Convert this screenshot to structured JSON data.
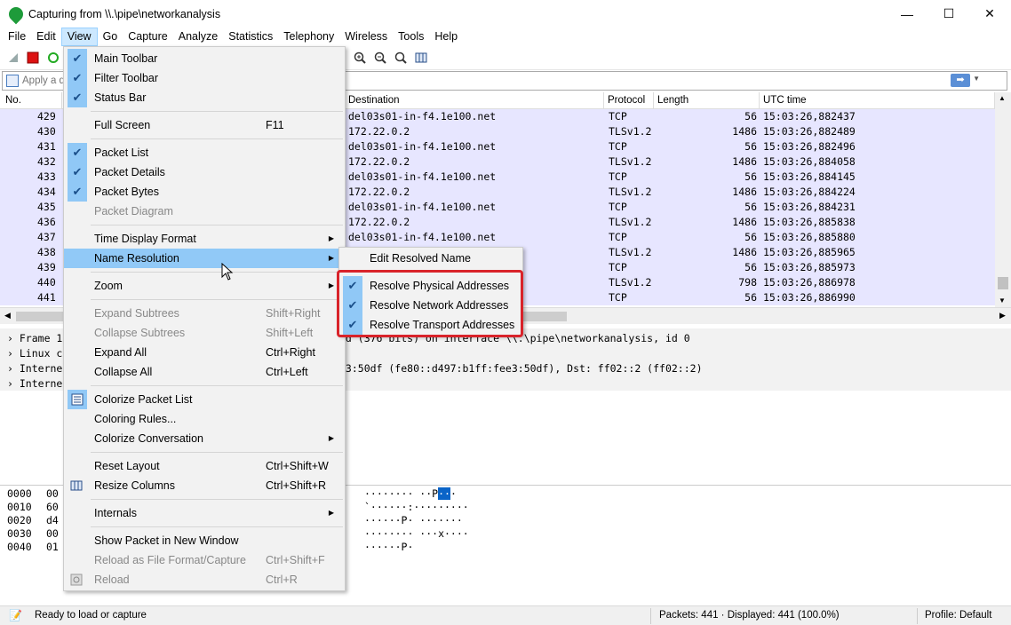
{
  "window": {
    "title": "Capturing from \\\\.\\pipe\\networkanalysis",
    "minimize": "—",
    "maximize": "☐",
    "close": "✕"
  },
  "menubar": [
    "File",
    "Edit",
    "View",
    "Go",
    "Capture",
    "Analyze",
    "Statistics",
    "Telephony",
    "Wireless",
    "Tools",
    "Help"
  ],
  "filter": {
    "placeholder": "Apply a di"
  },
  "packet_list": {
    "headers": {
      "no": "No.",
      "destination": "Destination",
      "protocol": "Protocol",
      "length": "Length",
      "utc": "UTC time"
    },
    "rows": [
      {
        "no": "429",
        "dst": "del03s01-in-f4.1e100.net",
        "proto": "TCP",
        "len": "56",
        "time": "15:03:26,882437"
      },
      {
        "no": "430",
        "dst": "172.22.0.2",
        "proto": "TLSv1.2",
        "len": "1486",
        "time": "15:03:26,882489"
      },
      {
        "no": "431",
        "dst": "del03s01-in-f4.1e100.net",
        "proto": "TCP",
        "len": "56",
        "time": "15:03:26,882496"
      },
      {
        "no": "432",
        "dst": "172.22.0.2",
        "proto": "TLSv1.2",
        "len": "1486",
        "time": "15:03:26,884058"
      },
      {
        "no": "433",
        "dst": "del03s01-in-f4.1e100.net",
        "proto": "TCP",
        "len": "56",
        "time": "15:03:26,884145"
      },
      {
        "no": "434",
        "dst": "172.22.0.2",
        "proto": "TLSv1.2",
        "len": "1486",
        "time": "15:03:26,884224"
      },
      {
        "no": "435",
        "dst": "del03s01-in-f4.1e100.net",
        "proto": "TCP",
        "len": "56",
        "time": "15:03:26,884231"
      },
      {
        "no": "436",
        "dst": "172.22.0.2",
        "proto": "TLSv1.2",
        "len": "1486",
        "time": "15:03:26,885838"
      },
      {
        "no": "437",
        "dst": "del03s01-in-f4.1e100.net",
        "proto": "TCP",
        "len": "56",
        "time": "15:03:26,885880"
      },
      {
        "no": "438",
        "dst": "",
        "proto": "TLSv1.2",
        "len": "1486",
        "time": "15:03:26,885965"
      },
      {
        "no": "439",
        "dst": "",
        "proto": "TCP",
        "len": "56",
        "time": "15:03:26,885973"
      },
      {
        "no": "440",
        "dst": "",
        "proto": "TLSv1.2",
        "len": "798",
        "time": "15:03:26,886978"
      },
      {
        "no": "441",
        "dst": "",
        "proto": "TCP",
        "len": "56",
        "time": "15:03:26,886990"
      }
    ]
  },
  "details": {
    "rows": [
      {
        "left": "Frame 1",
        "right": "ed (376 bits) on interface \\\\.\\pipe\\networkanalysis, id 0"
      },
      {
        "left": "Linux c",
        "right": ""
      },
      {
        "left": "Interne",
        "right": "e3:50df (fe80::d497:b1ff:fee3:50df), Dst: ff02::2 (ff02::2)"
      },
      {
        "left": "Interne",
        "right": ""
      }
    ]
  },
  "bytes": {
    "rows": [
      {
        "offset": "0000",
        "hex": "00",
        "ascii": "········ ··P"
      },
      {
        "offset": "0010",
        "hex": "60",
        "ascii": "`······:·········"
      },
      {
        "offset": "0020",
        "hex": "d4",
        "ascii": "······P· ·······"
      },
      {
        "offset": "0030",
        "hex": "00",
        "ascii": "········ ···x····"
      },
      {
        "offset": "0040",
        "hex": "01",
        "ascii": "······P·"
      }
    ],
    "highlight": "··"
  },
  "view_menu": {
    "items": {
      "main_toolbar": "Main Toolbar",
      "filter_toolbar": "Filter Toolbar",
      "status_bar": "Status Bar",
      "full_screen": "Full Screen",
      "full_screen_sc": "F11",
      "packet_list": "Packet List",
      "packet_details": "Packet Details",
      "packet_bytes": "Packet Bytes",
      "packet_diagram": "Packet Diagram",
      "time_display_format": "Time Display Format",
      "name_resolution": "Name Resolution",
      "zoom": "Zoom",
      "expand_subtrees": "Expand Subtrees",
      "expand_subtrees_sc": "Shift+Right",
      "collapse_subtrees": "Collapse Subtrees",
      "collapse_subtrees_sc": "Shift+Left",
      "expand_all": "Expand All",
      "expand_all_sc": "Ctrl+Right",
      "collapse_all": "Collapse All",
      "collapse_all_sc": "Ctrl+Left",
      "colorize_packet_list": "Colorize Packet List",
      "coloring_rules": "Coloring Rules...",
      "colorize_conversation": "Colorize Conversation",
      "reset_layout": "Reset Layout",
      "reset_layout_sc": "Ctrl+Shift+W",
      "resize_columns": "Resize Columns",
      "resize_columns_sc": "Ctrl+Shift+R",
      "internals": "Internals",
      "show_packet_new_window": "Show Packet in New Window",
      "reload_as_file_format": "Reload as File Format/Capture",
      "reload_as_file_format_sc": "Ctrl+Shift+F",
      "reload": "Reload",
      "reload_sc": "Ctrl+R"
    }
  },
  "name_resolution_menu": {
    "edit_resolved_name": "Edit Resolved Name",
    "resolve_physical": "Resolve Physical Addresses",
    "resolve_network": "Resolve Network Addresses",
    "resolve_transport": "Resolve Transport Addresses"
  },
  "status": {
    "ready": "Ready to load or capture",
    "packets": "Packets: 441 · Displayed: 441 (100.0%)",
    "profile": "Profile: Default"
  },
  "colors": {
    "row_bg": "#e7e6ff",
    "menu_hover": "#91c9f7",
    "highlight_box": "#d9232a",
    "selection": "#0a64c8"
  }
}
